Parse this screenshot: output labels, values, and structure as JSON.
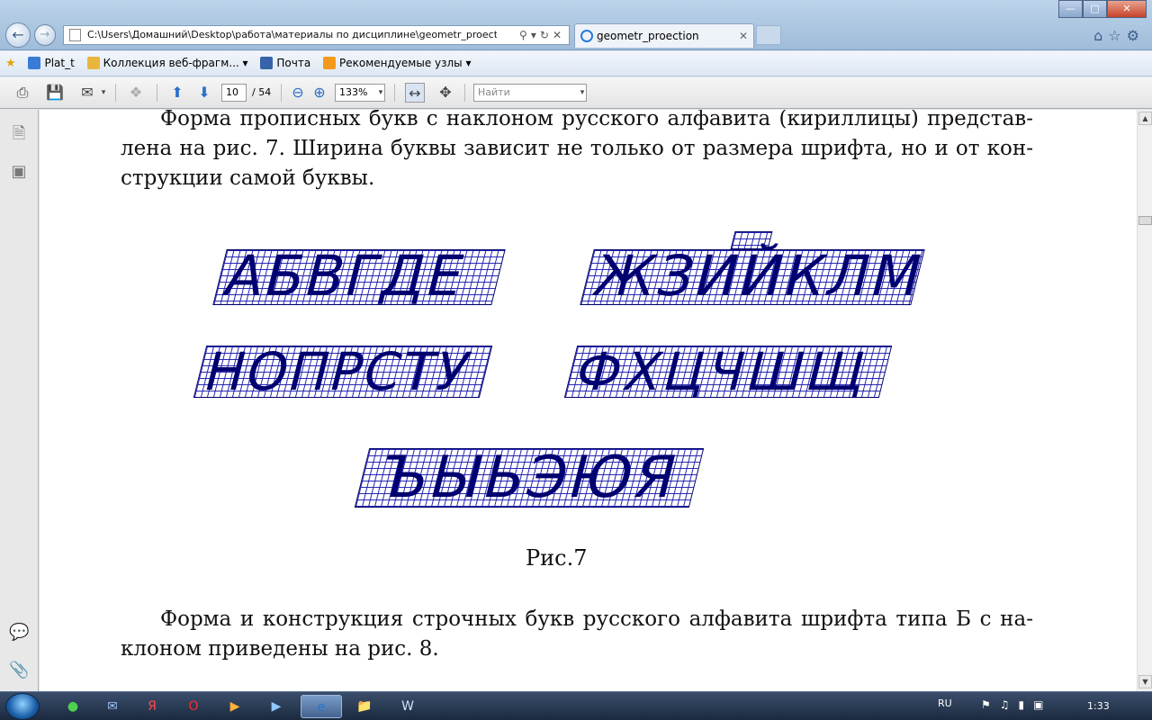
{
  "browser": {
    "address": "C:\\Users\\Домашний\\Desktop\\работа\\материалы по дисциплине\\geometr_proection.p",
    "tab_title": "geometr_proection"
  },
  "favorites": {
    "items": [
      "Plat_t",
      "Коллекция веб-фрагм...",
      "Почта",
      "Рекомендуемые узлы"
    ]
  },
  "pdf_toolbar": {
    "page_current": "10",
    "page_total": "/ 54",
    "zoom": "133%",
    "find_placeholder": "Найти"
  },
  "document": {
    "para1": [
      "Форма прописных букв с наклоном  русского алфавита (кириллицы) представ-",
      "лена на рис. 7. Ширина буквы зависит не только от размера шрифта, но и от кон-",
      "струкции самой буквы."
    ],
    "figure": {
      "row1_left": "АБВГДЕ",
      "row1_right": "ЖЗИЙКЛМ",
      "row2_left": "НОПРСТУ",
      "row2_right": "ФХЦЧШЩ",
      "row3": "ЪЫЬЭЮЯ"
    },
    "caption": "Рис.7",
    "para2": [
      "Форма и конструкция строчных букв русского алфавита шрифта типа Б с на-",
      "клоном приведены на рис. 8."
    ]
  },
  "taskbar": {
    "language": "RU",
    "clock": "1:33"
  },
  "colors": {
    "grid": "#1f1fb0",
    "letters": "#000070",
    "emphasis_letters": "#000000"
  }
}
